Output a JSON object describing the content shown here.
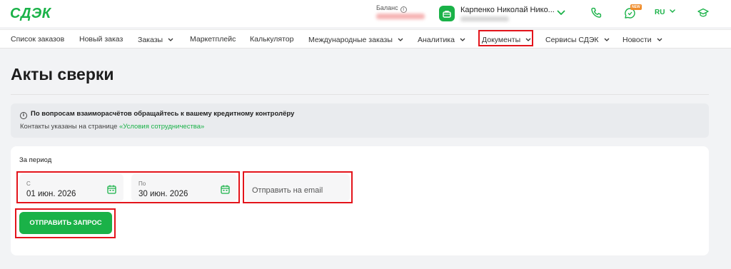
{
  "header": {
    "logo": "СДЭК",
    "balance_label": "Баланс",
    "balance_info_icon": "info-icon",
    "user_name": "Карпенко Николай Нико...",
    "new_badge": "NEW",
    "language": "RU",
    "brand_color": "#1ab248"
  },
  "nav": {
    "items": [
      {
        "label": "Список заказов"
      },
      {
        "label": "Новый заказ"
      },
      {
        "label": "Заказы"
      },
      {
        "label": "Маркетплейс"
      },
      {
        "label": "Калькулятор"
      },
      {
        "label": "Международные заказы"
      },
      {
        "label": "Аналитика"
      },
      {
        "label": "Документы"
      },
      {
        "label": "Сервисы СДЭК"
      },
      {
        "label": "Новости"
      }
    ]
  },
  "page": {
    "title": "Акты сверки"
  },
  "notice": {
    "icon": "info-icon",
    "title": "По вопросам взаиморасчётов обращайтесь к вашему кредитному контролёру",
    "text": "Контакты указаны на странице ",
    "link": "«Условия сотрудничества»"
  },
  "form": {
    "period_label": "За период",
    "from_label": "С",
    "from_value": "01 июн. 2026",
    "to_label": "По",
    "to_value": "30 июн. 2026",
    "email_placeholder": "Отправить на email",
    "submit_label": "ОТПРАВИТЬ ЗАПРОС"
  },
  "colors": {
    "accent": "#1ab248",
    "highlight": "#e3141b",
    "badge": "#f08c2a"
  }
}
